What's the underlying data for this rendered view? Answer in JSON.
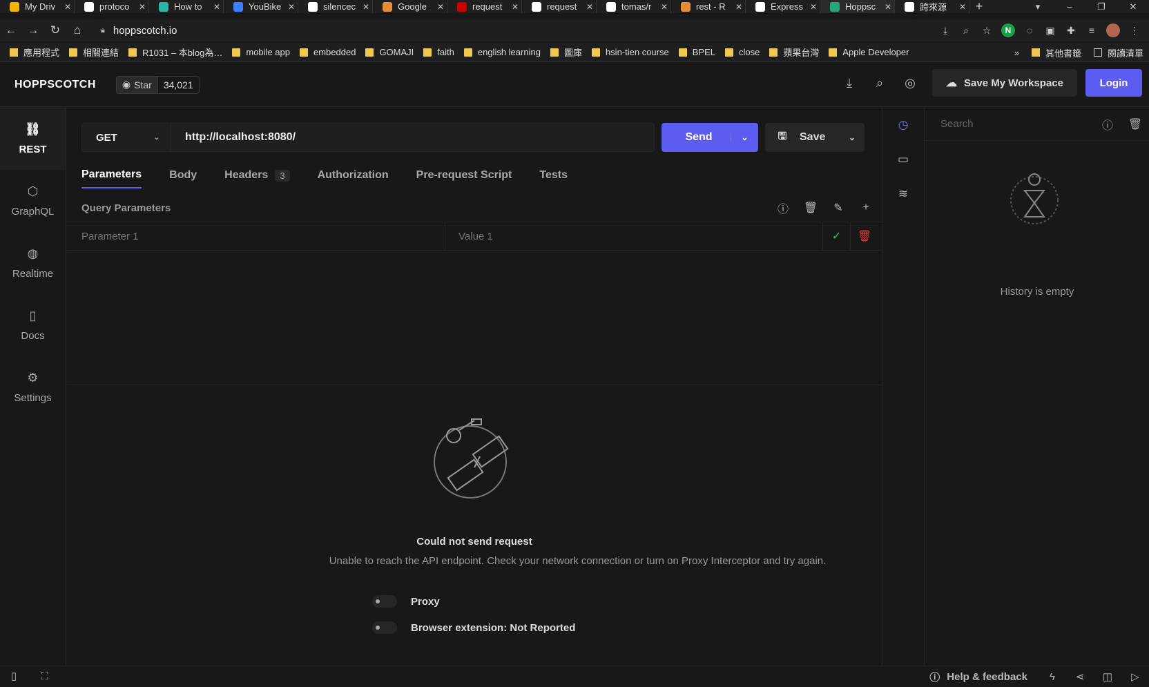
{
  "browser": {
    "tabs": [
      {
        "title": "My Driv",
        "color": "#f4b400"
      },
      {
        "title": "protoco",
        "color": "#ffffff"
      },
      {
        "title": "How to",
        "color": "#2bb5a5"
      },
      {
        "title": "YouBike",
        "color": "#3d7eff"
      },
      {
        "title": "silencec",
        "color": "#ffffff"
      },
      {
        "title": "Google",
        "color": "#e58c3a"
      },
      {
        "title": "request",
        "color": "#c00"
      },
      {
        "title": "request",
        "color": "#ffffff"
      },
      {
        "title": "tomas/r",
        "color": "#ffffff"
      },
      {
        "title": "rest - R",
        "color": "#e58c3a"
      },
      {
        "title": "Express",
        "color": "#ffffff"
      },
      {
        "title": "Hoppsc",
        "color": "#22a67a"
      },
      {
        "title": "跨來源",
        "color": "#ffffff"
      }
    ],
    "new_tab": "+",
    "url": "hoppscotch.io",
    "bookmarks": [
      "應用程式",
      "相關連結",
      "R1031 – 本blog為…",
      "mobile app",
      "embedded",
      "GOMAJI",
      "faith",
      "english learning",
      "圖庫",
      "hsin-tien course",
      "BPEL",
      "close",
      "蘋果台灣",
      "Apple Developer"
    ],
    "bookmarks_overflow": "»",
    "other_bookmarks": "其他書籤",
    "reading_list": "閱讀清單"
  },
  "app": {
    "brand": "HOPPSCOTCH",
    "star_label": "Star",
    "star_count": "34,021",
    "save_workspace": "Save My Workspace",
    "login": "Login",
    "accent": "#5c5cf0"
  },
  "sidenav": [
    {
      "label": "REST",
      "icon": "link-icon",
      "glyph": "⛓"
    },
    {
      "label": "GraphQL",
      "icon": "graphql-icon",
      "glyph": "⬡"
    },
    {
      "label": "Realtime",
      "icon": "globe-icon",
      "glyph": "◍"
    },
    {
      "label": "Docs",
      "icon": "book-icon",
      "glyph": "▯"
    },
    {
      "label": "Settings",
      "icon": "gear-icon",
      "glyph": "⚙"
    }
  ],
  "request": {
    "method": "GET",
    "url": "http://localhost:8080/",
    "send": "Send",
    "save": "Save"
  },
  "tabs": {
    "parameters": "Parameters",
    "body": "Body",
    "headers": "Headers",
    "headers_count": "3",
    "authorization": "Authorization",
    "prerequest": "Pre-request Script",
    "tests": "Tests"
  },
  "params": {
    "title": "Query Parameters",
    "key_placeholder": "Parameter 1",
    "value_placeholder": "Value 1"
  },
  "response": {
    "error_title": "Could not send request",
    "error_message": "Unable to reach the API endpoint. Check your network connection or turn on Proxy Interceptor and try again.",
    "proxy": "Proxy",
    "extension": "Browser extension: Not Reported"
  },
  "history": {
    "search_placeholder": "Search",
    "empty": "History is empty"
  },
  "statusbar": {
    "help": "Help & feedback"
  }
}
